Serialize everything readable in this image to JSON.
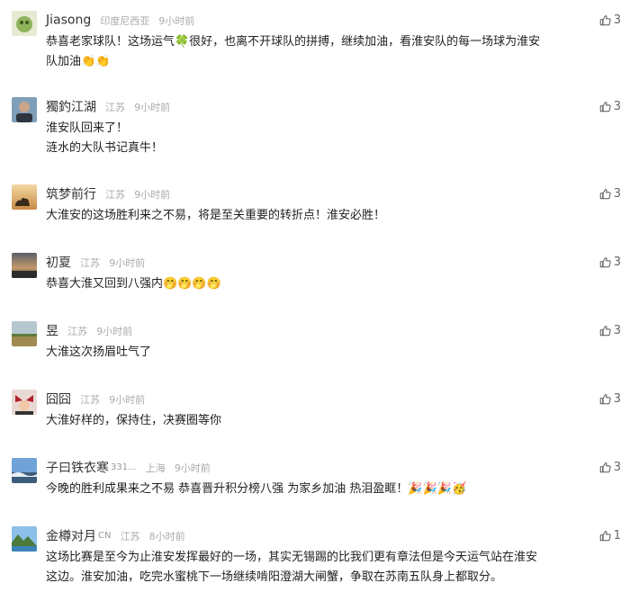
{
  "comments": [
    {
      "user": "Jiasong",
      "badge": "",
      "location": "印度尼西亚",
      "time": "9小时前",
      "likes": "3",
      "avatar_icon": "green-blob-avatar",
      "lines": [
        "恭喜老家球队！这场运气🍀很好，也离不开球队的拼搏，继续加油，看淮安队的每一场球为淮安",
        "队加油👏👏"
      ]
    },
    {
      "user": "獨釣江湖",
      "badge": "",
      "location": "江苏",
      "time": "9小时前",
      "likes": "3",
      "avatar_icon": "man-photo-avatar",
      "lines": [
        "淮安队回来了！",
        "涟水的大队书记真牛！"
      ]
    },
    {
      "user": "筑梦前行",
      "badge": "",
      "location": "江苏",
      "time": "9小时前",
      "likes": "3",
      "avatar_icon": "camel-sunset-avatar",
      "lines": [
        "大淮安的这场胜利来之不易，将是至关重要的转折点！淮安必胜！"
      ]
    },
    {
      "user": "初夏",
      "badge": "",
      "location": "江苏",
      "time": "9小时前",
      "likes": "3",
      "avatar_icon": "dusk-landscape-avatar",
      "lines": [
        "恭喜大淮又回到八强内🤭🤭🤭🤭"
      ]
    },
    {
      "user": "昱",
      "badge": "",
      "location": "江苏",
      "time": "9小时前",
      "likes": "3",
      "avatar_icon": "field-landscape-avatar",
      "lines": [
        "大淮这次扬眉吐气了"
      ]
    },
    {
      "user": "囧囧",
      "badge": "",
      "location": "江苏",
      "time": "9小时前",
      "likes": "3",
      "avatar_icon": "character-avatar",
      "lines": [
        "大淮好样的，保持住，决赛圈等你"
      ]
    },
    {
      "user": "子曰铁衣寒",
      "badge": "331...",
      "location": "上海",
      "time": "9小时前",
      "likes": "3",
      "avatar_icon": "sky-landscape-avatar",
      "lines": [
        "今晚的胜利成果来之不易 恭喜晋升积分榜八强 为家乡加油 热泪盈眶！🎉🎉🎉🥳"
      ]
    },
    {
      "user": "金樽对月",
      "badge": "CN",
      "location": "江苏",
      "time": "8小时前",
      "likes": "1",
      "avatar_icon": "mountain-lake-avatar",
      "lines": [
        "这场比赛是至今为止淮安发挥最好的一场，其实无锡踢的比我们更有章法但是今天运气站在淮安",
        "这边。淮安加油，吃完水蜜桃下一场继续啃阳澄湖大闸蟹，争取在苏南五队身上都取分。"
      ]
    }
  ]
}
